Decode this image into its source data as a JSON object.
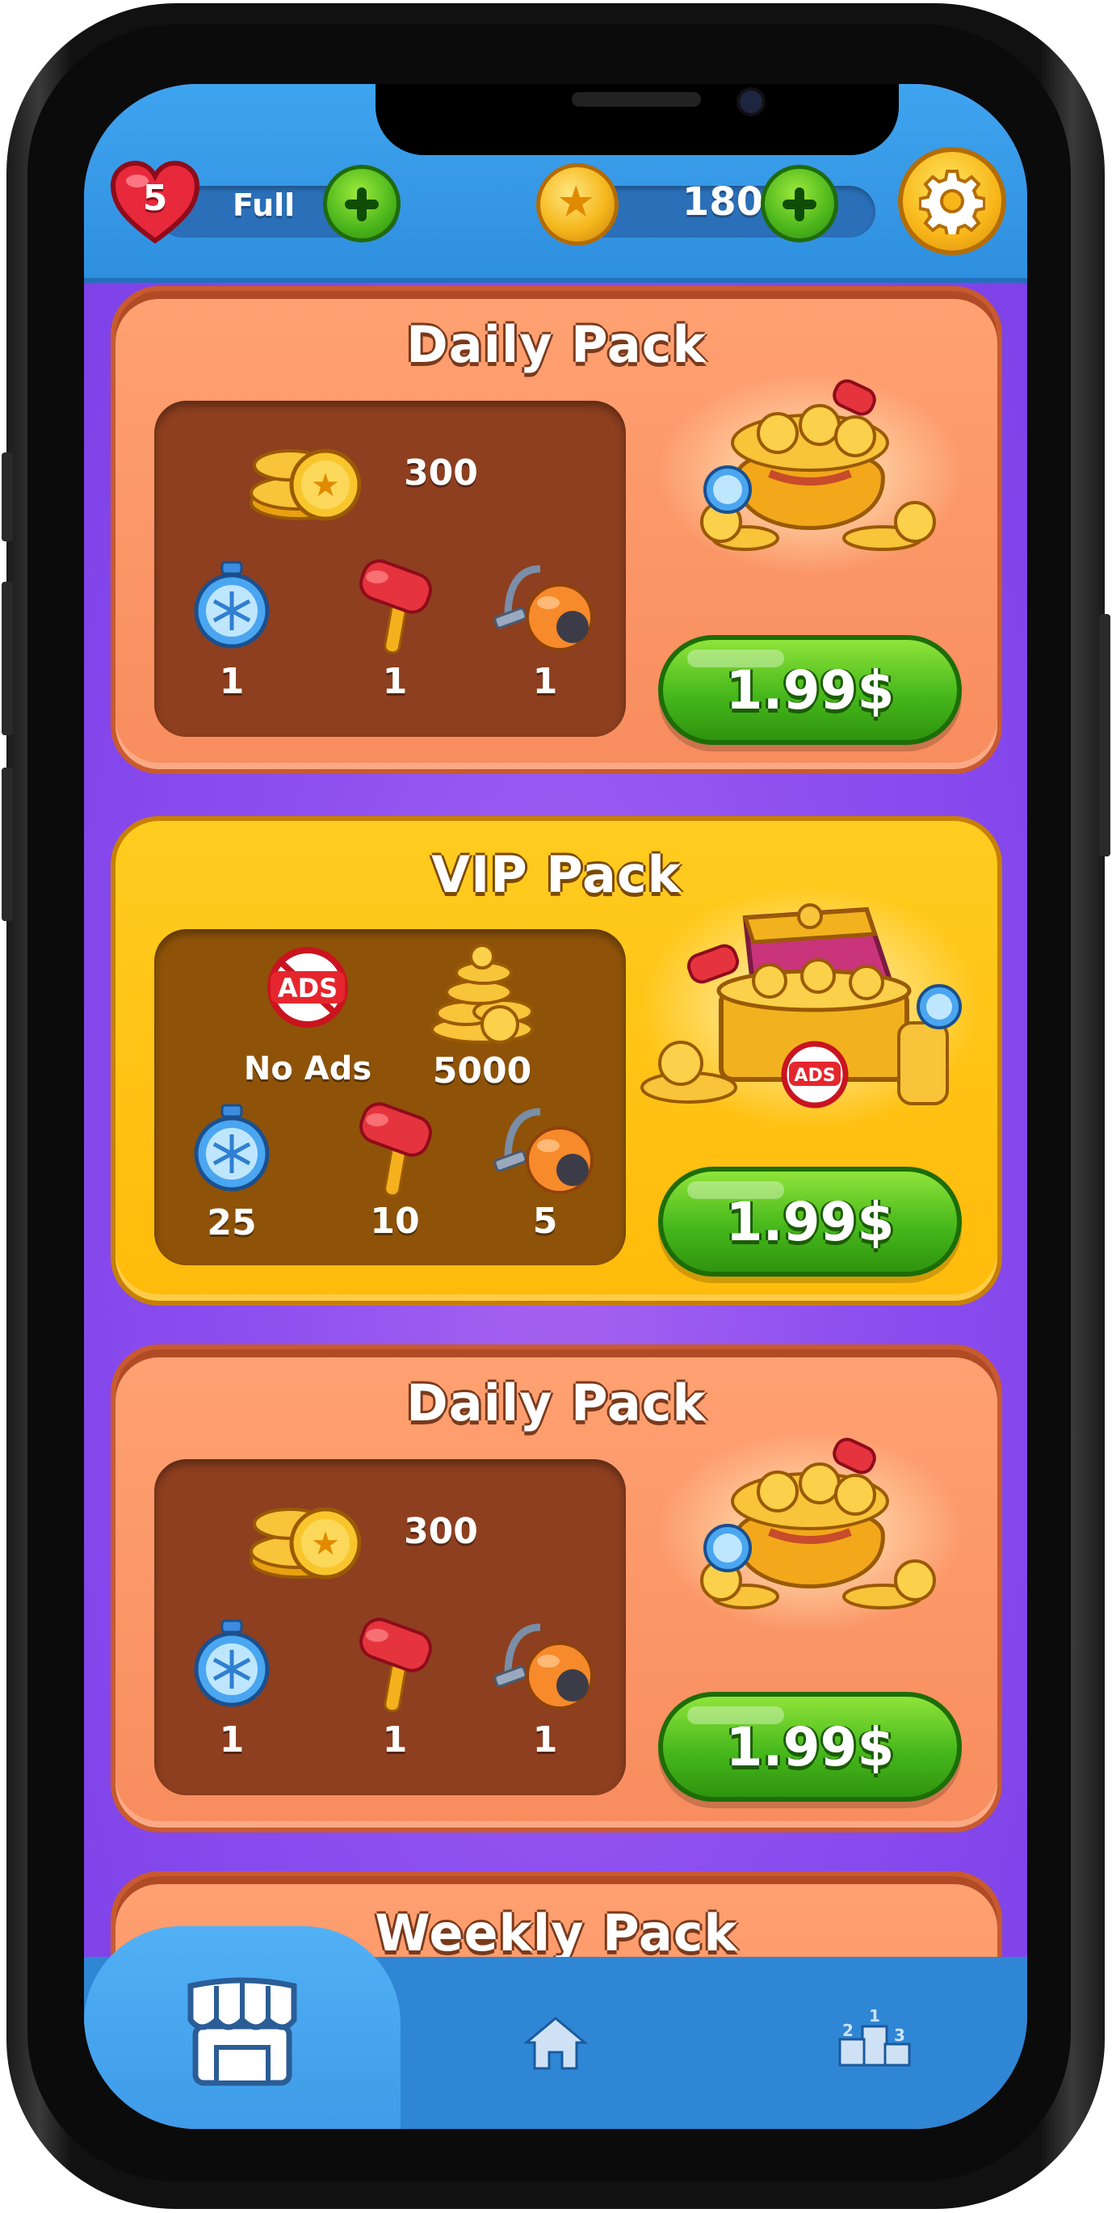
{
  "topbar": {
    "lives": "5",
    "lives_status": "Full",
    "coins": "180"
  },
  "packs": [
    {
      "title": "Daily Pack",
      "coins": "300",
      "items": [
        {
          "icon": "stopwatch-icon",
          "qty": "1"
        },
        {
          "icon": "hammer-icon",
          "qty": "1"
        },
        {
          "icon": "vacuum-icon",
          "qty": "1"
        }
      ],
      "price": "1.99$"
    },
    {
      "title": "VIP Pack",
      "no_ads_label": "No Ads",
      "ads_badge": "ADS",
      "coins": "5000",
      "items": [
        {
          "icon": "stopwatch-icon",
          "qty": "25"
        },
        {
          "icon": "hammer-icon",
          "qty": "10"
        },
        {
          "icon": "vacuum-icon",
          "qty": "5"
        }
      ],
      "price": "1.99$"
    },
    {
      "title": "Daily Pack",
      "coins": "300",
      "items": [
        {
          "icon": "stopwatch-icon",
          "qty": "1"
        },
        {
          "icon": "hammer-icon",
          "qty": "1"
        },
        {
          "icon": "vacuum-icon",
          "qty": "1"
        }
      ],
      "price": "1.99$"
    },
    {
      "title": "Weekly Pack"
    }
  ],
  "nav": {
    "items": [
      {
        "icon": "shop-icon",
        "active": true
      },
      {
        "icon": "home-icon",
        "active": false
      },
      {
        "icon": "leaderboard-icon",
        "active": false
      }
    ],
    "podium_digits": [
      "2",
      "1",
      "3"
    ]
  },
  "colors": {
    "background": "#8e4ff0",
    "topbar": "#3fa4ef",
    "daily_card": "#f88d5e",
    "vip_card": "#ffbb0b",
    "price_button": "#47b81c"
  }
}
